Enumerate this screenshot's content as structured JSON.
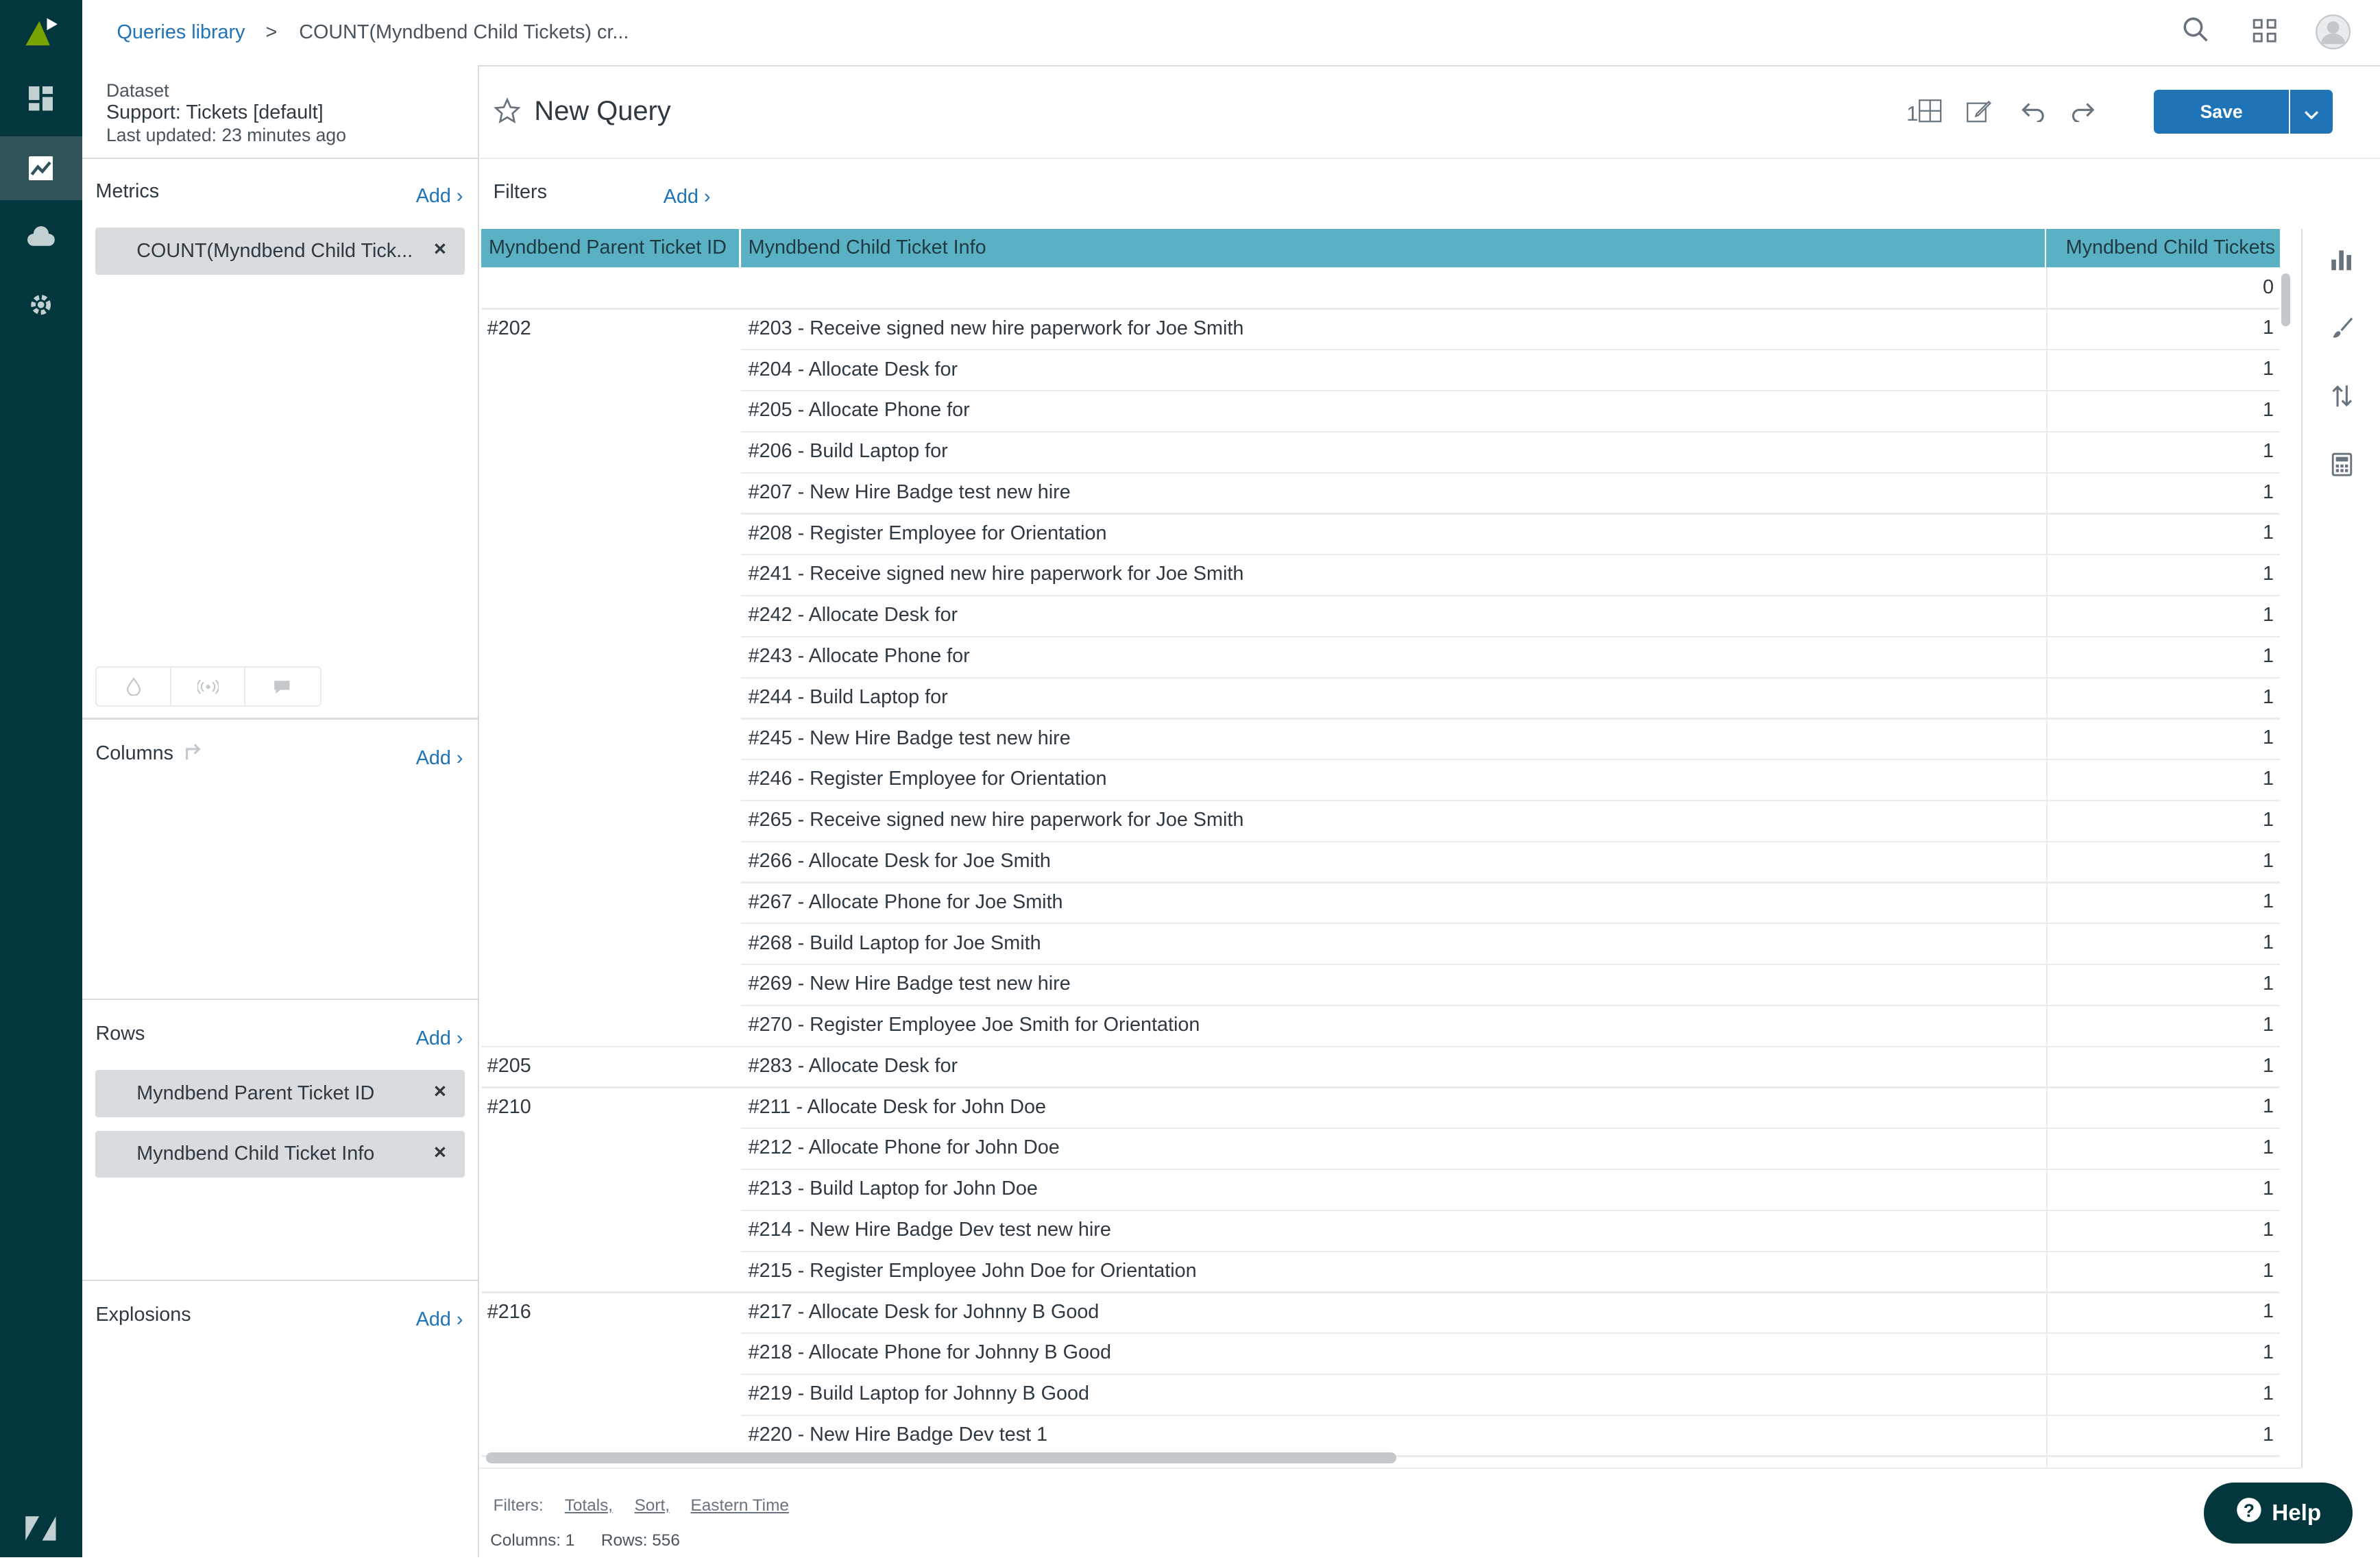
{
  "breadcrumb": {
    "root": "Queries library",
    "separator": ">",
    "current": "COUNT(Myndbend Child Tickets) cr..."
  },
  "dataset": {
    "label": "Dataset",
    "name": "Support: Tickets [default]",
    "updated": "Last updated: 23 minutes ago"
  },
  "query": {
    "title": "New Query",
    "save_label": "Save",
    "format_label": "1"
  },
  "metrics": {
    "title": "Metrics",
    "add": "Add",
    "items": [
      "COUNT(Myndbend Child Tick..."
    ]
  },
  "columns": {
    "title": "Columns",
    "add": "Add"
  },
  "rows": {
    "title": "Rows",
    "add": "Add",
    "items": [
      "Myndbend Parent Ticket ID",
      "Myndbend Child Ticket Info"
    ]
  },
  "explosions": {
    "title": "Explosions",
    "add": "Add"
  },
  "filters": {
    "title": "Filters",
    "add": "Add"
  },
  "table": {
    "headers": [
      "Myndbend Parent Ticket ID",
      "Myndbend Child Ticket Info",
      "Myndbend Child Tickets"
    ],
    "rows": [
      {
        "parent": "",
        "child": "",
        "value": "0"
      },
      {
        "parent": "#202",
        "child": "#203 - Receive signed new hire paperwork for Joe Smith",
        "value": "1"
      },
      {
        "parent": "",
        "child": "#204 - Allocate Desk for",
        "value": "1"
      },
      {
        "parent": "",
        "child": "#205 - Allocate Phone for",
        "value": "1"
      },
      {
        "parent": "",
        "child": "#206 - Build Laptop for",
        "value": "1"
      },
      {
        "parent": "",
        "child": "#207 - New Hire Badge test new hire",
        "value": "1"
      },
      {
        "parent": "",
        "child": "#208 - Register Employee for Orientation",
        "value": "1"
      },
      {
        "parent": "",
        "child": "#241 - Receive signed new hire paperwork for Joe Smith",
        "value": "1"
      },
      {
        "parent": "",
        "child": "#242 - Allocate Desk for",
        "value": "1"
      },
      {
        "parent": "",
        "child": "#243 - Allocate Phone for",
        "value": "1"
      },
      {
        "parent": "",
        "child": "#244 - Build Laptop for",
        "value": "1"
      },
      {
        "parent": "",
        "child": "#245 - New Hire Badge test new hire",
        "value": "1"
      },
      {
        "parent": "",
        "child": "#246 - Register Employee for Orientation",
        "value": "1"
      },
      {
        "parent": "",
        "child": "#265 - Receive signed new hire paperwork for Joe Smith",
        "value": "1"
      },
      {
        "parent": "",
        "child": "#266 - Allocate Desk for Joe Smith",
        "value": "1"
      },
      {
        "parent": "",
        "child": "#267 - Allocate Phone for Joe Smith",
        "value": "1"
      },
      {
        "parent": "",
        "child": "#268 - Build Laptop for Joe Smith",
        "value": "1"
      },
      {
        "parent": "",
        "child": "#269 - New Hire Badge test new hire",
        "value": "1"
      },
      {
        "parent": "",
        "child": "#270 - Register Employee Joe Smith for Orientation",
        "value": "1"
      },
      {
        "parent": "#205",
        "child": "#283 - Allocate Desk for",
        "value": "1"
      },
      {
        "parent": "#210",
        "child": "#211 - Allocate Desk for John Doe",
        "value": "1"
      },
      {
        "parent": "",
        "child": "#212 - Allocate Phone for John Doe",
        "value": "1"
      },
      {
        "parent": "",
        "child": "#213 - Build Laptop for John Doe",
        "value": "1"
      },
      {
        "parent": "",
        "child": "#214 - New Hire Badge Dev test new hire",
        "value": "1"
      },
      {
        "parent": "",
        "child": "#215 - Register Employee John Doe for Orientation",
        "value": "1"
      },
      {
        "parent": "#216",
        "child": "#217 - Allocate Desk for Johnny B Good",
        "value": "1"
      },
      {
        "parent": "",
        "child": "#218 - Allocate Phone for Johnny B Good",
        "value": "1"
      },
      {
        "parent": "",
        "child": "#219 - Build Laptop for Johnny B Good",
        "value": "1"
      },
      {
        "parent": "",
        "child": "#220 - New Hire Badge Dev test 1",
        "value": "1"
      }
    ]
  },
  "footer": {
    "filters_label": "Filters:",
    "totals": "Totals,",
    "sort": "Sort,",
    "timezone": "Eastern Time",
    "columns": "Columns: 1",
    "rows": "Rows: 556"
  },
  "help": {
    "label": "Help"
  },
  "colors": {
    "nav_bg": "#03363d",
    "accent": "#1f73b7",
    "header_bg": "#5ab1c4"
  }
}
